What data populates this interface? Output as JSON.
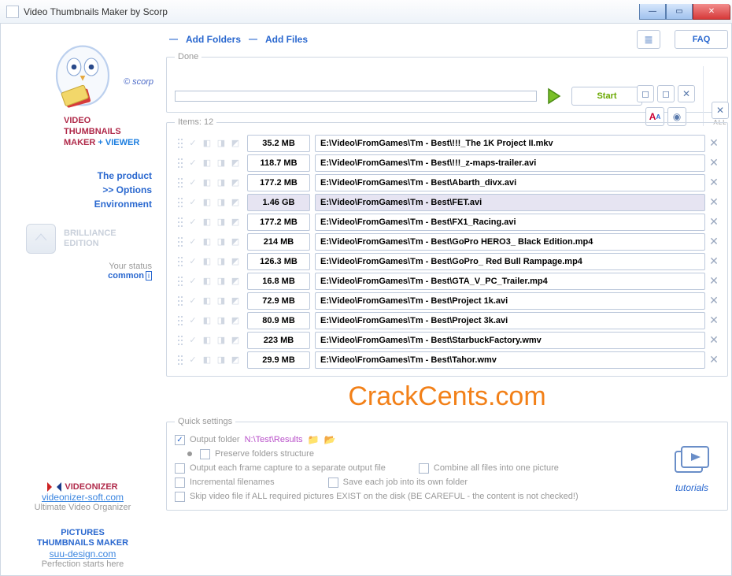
{
  "title": "Video Thumbnails Maker by Scorp",
  "top": {
    "add_folders": "Add Folders",
    "add_files": "Add Files",
    "faq": "FAQ"
  },
  "done": {
    "legend": "Done",
    "start": "Start",
    "all": "ALL"
  },
  "sidebar": {
    "scorp": "© scorp",
    "brand1": "VIDEO",
    "brand2": "THUMBNAILS",
    "brand3a": "MAKER",
    "brand3b": "+",
    "brand3c": "VIEWER",
    "nav_product": "The product",
    "nav_options": ">> Options",
    "nav_env": "Environment",
    "brill1": "BRILLIANCE",
    "brill2": "EDITION",
    "status_lbl": "Your status",
    "status_val": "common",
    "status_i": "i",
    "vz_h": "VIDEONIZER",
    "vz_link": "videonizer-soft.com",
    "vz_sub": "Ultimate Video Organizer",
    "ptm_h1": "PICTURES",
    "ptm_h2": "THUMBNAILS MAKER",
    "ptm_link": "suu-design.com",
    "ptm_sub": "Perfection starts here"
  },
  "items": {
    "legend": "Items: 12",
    "rows": [
      {
        "size": "35.2 MB",
        "path": "E:\\Video\\FromGames\\Tm - Best\\!!!_The 1K Project II.mkv",
        "sel": false
      },
      {
        "size": "118.7 MB",
        "path": "E:\\Video\\FromGames\\Tm - Best\\!!!_z-maps-trailer.avi",
        "sel": false
      },
      {
        "size": "177.2 MB",
        "path": "E:\\Video\\FromGames\\Tm - Best\\Abarth_divx.avi",
        "sel": false
      },
      {
        "size": "1.46 GB",
        "path": "E:\\Video\\FromGames\\Tm - Best\\FET.avi",
        "sel": true
      },
      {
        "size": "177.2 MB",
        "path": "E:\\Video\\FromGames\\Tm - Best\\FX1_Racing.avi",
        "sel": false
      },
      {
        "size": "214 MB",
        "path": "E:\\Video\\FromGames\\Tm - Best\\GoPro HERO3_ Black Edition.mp4",
        "sel": false
      },
      {
        "size": "126.3 MB",
        "path": "E:\\Video\\FromGames\\Tm - Best\\GoPro_ Red Bull Rampage.mp4",
        "sel": false
      },
      {
        "size": "16.8 MB",
        "path": "E:\\Video\\FromGames\\Tm - Best\\GTA_V_PC_Trailer.mp4",
        "sel": false
      },
      {
        "size": "72.9 MB",
        "path": "E:\\Video\\FromGames\\Tm - Best\\Project 1k.avi",
        "sel": false
      },
      {
        "size": "80.9 MB",
        "path": "E:\\Video\\FromGames\\Tm - Best\\Project 3k.avi",
        "sel": false
      },
      {
        "size": "223 MB",
        "path": "E:\\Video\\FromGames\\Tm - Best\\StarbuckFactory.wmv",
        "sel": false
      },
      {
        "size": "29.9 MB",
        "path": "E:\\Video\\FromGames\\Tm - Best\\Tahor.wmv",
        "sel": false
      }
    ]
  },
  "watermark": "CrackCents.com",
  "quick": {
    "legend": "Quick settings",
    "output_folder_lbl": "Output folder",
    "output_folder_path": "N:\\Test\\Results",
    "preserve": "Preserve folders structure",
    "outeach": "Output each frame capture to a separate output file",
    "combine": "Combine all files into one picture",
    "incremental": "Incremental filenames",
    "saveeach": "Save each job into its own folder",
    "skip": "Skip video file if ALL required pictures EXIST on the disk (BE CAREFUL - the content is not checked!)",
    "tutorials": "tutorials"
  }
}
